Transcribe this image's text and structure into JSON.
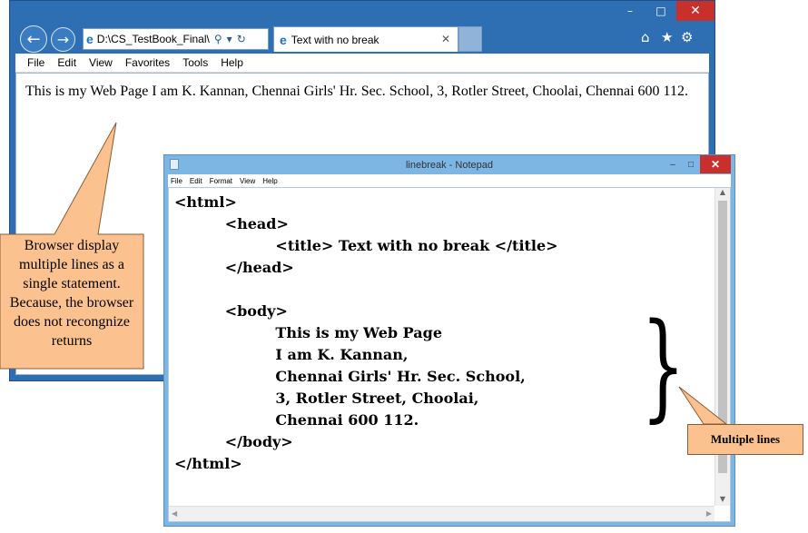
{
  "browser": {
    "address": "D:\\CS_TestBook_Final\\",
    "tab_title": "Text with no break",
    "window_controls": {
      "minimize": "–",
      "maximize": "□",
      "close": "✕"
    },
    "menu": [
      "File",
      "Edit",
      "View",
      "Favorites",
      "Tools",
      "Help"
    ],
    "page_text": "This is my Web Page I am K. Kannan, Chennai Girls' Hr. Sec. School, 3, Rotler Street, Choolai, Chennai 600 112."
  },
  "notepad": {
    "title": "linebreak - Notepad",
    "window_controls": {
      "minimize": "–",
      "maximize": "□",
      "close": "✕"
    },
    "menu": [
      "File",
      "Edit",
      "Format",
      "View",
      "Help"
    ],
    "lines": [
      "<html>",
      "          <head>",
      "                    <title> Text with no break </title>",
      "          </head>",
      "",
      "          <body>",
      "                    This is my Web Page",
      "                    I am K. Kannan,",
      "                    Chennai Girls' Hr. Sec. School,",
      "                    3, Rotler Street, Choolai,",
      "                    Chennai 600 112.",
      "          </body>",
      "</html>"
    ]
  },
  "callouts": {
    "left_lines": [
      "Browser display",
      "multiple lines as a",
      "single statement.",
      "Because, the browser",
      "does not recongnize",
      "returns"
    ],
    "right_label": "Multiple lines"
  },
  "icons": [
    "back-icon",
    "forward-icon",
    "search-icon",
    "refresh-icon",
    "ie-logo-icon",
    "home-icon",
    "favorites-star-icon",
    "settings-gear-icon",
    "notepad-icon"
  ],
  "colors": {
    "titlebar": "#2e6fb4",
    "close": "#c9302c",
    "callout": "#fbc28f",
    "notepad_frame": "#7cb6e4"
  }
}
